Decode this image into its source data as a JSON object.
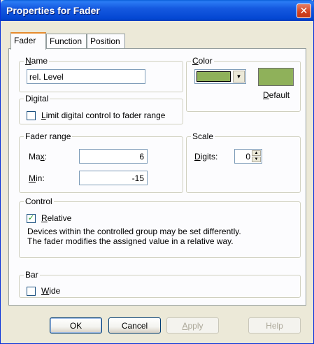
{
  "window": {
    "title": "Properties for Fader",
    "close_glyph": "✕"
  },
  "tabs": [
    {
      "label": "Fader",
      "active": true
    },
    {
      "label": "Function",
      "active": false
    },
    {
      "label": "Position",
      "active": false
    }
  ],
  "name_group": {
    "legend_u": "N",
    "legend_rest": "ame",
    "value": "rel. Level"
  },
  "color_group": {
    "legend_u": "C",
    "legend_rest": "olor",
    "selected_color": "#8fb15a",
    "dropdown_glyph": "▼",
    "default_u": "D",
    "default_rest": "efault"
  },
  "digital_group": {
    "legend": "Digital",
    "checkbox_u": "L",
    "checkbox_rest": "imit digital control to fader range",
    "checked": false
  },
  "fader_range_group": {
    "legend": "Fader range",
    "max_pre": "Ma",
    "max_u": "x",
    "max_post": ":",
    "max_value": "6",
    "min_u": "M",
    "min_rest": "in:",
    "min_value": "-15"
  },
  "scale_group": {
    "legend": "Scale",
    "digits_u": "D",
    "digits_rest": "igits:",
    "digits_value": "0",
    "up_glyph": "▲",
    "down_glyph": "▼"
  },
  "control_group": {
    "legend": "Control",
    "relative_u": "R",
    "relative_rest": "elative",
    "relative_checked": true,
    "check_glyph": "✓",
    "description_line1": "Devices within the controlled group may be set differently.",
    "description_line2": "The fader modifies the assigned value in a relative way."
  },
  "bar_group": {
    "legend": "Bar",
    "wide_u": "W",
    "wide_rest": "ide",
    "wide_checked": false
  },
  "buttons": {
    "ok": "OK",
    "cancel": "Cancel",
    "apply_u": "A",
    "apply_rest": "pply",
    "help": "Help"
  }
}
